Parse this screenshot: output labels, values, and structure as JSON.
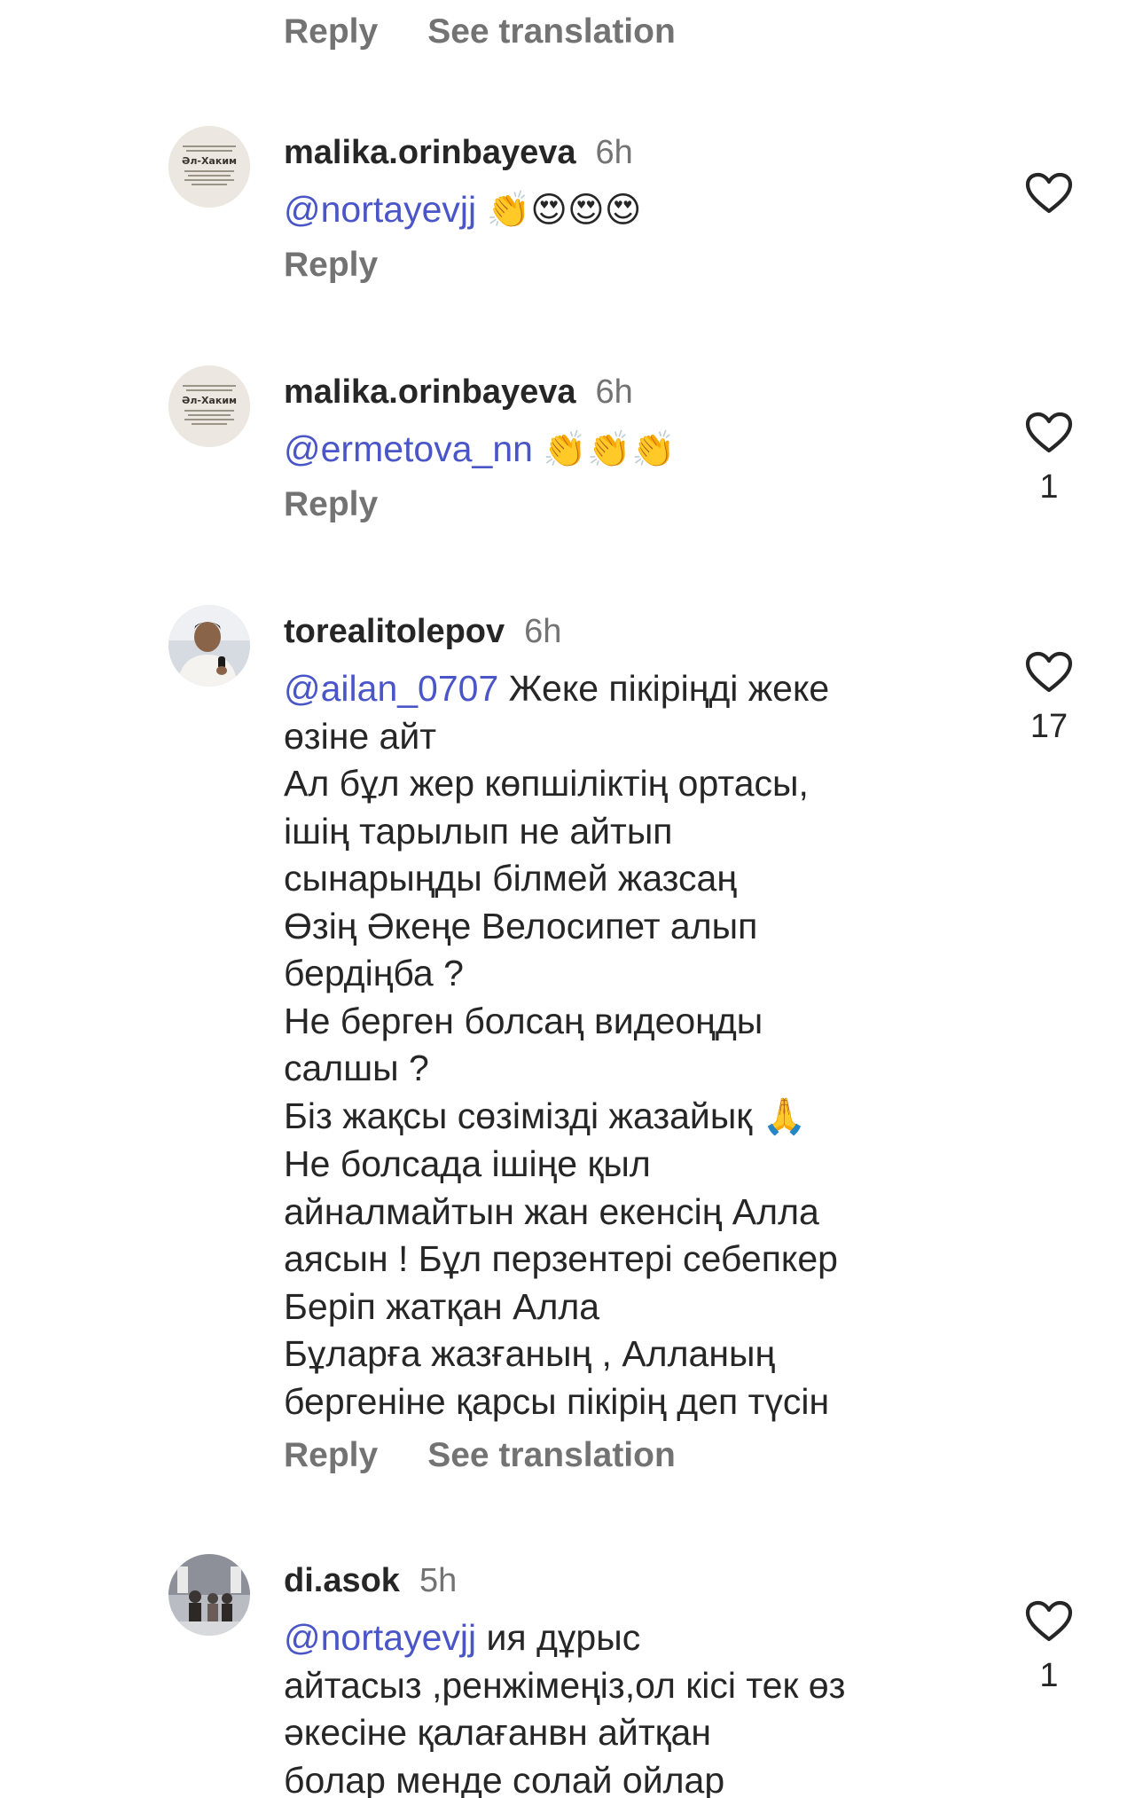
{
  "top_actions": {
    "reply": "Reply",
    "see_translation": "See translation"
  },
  "comments": [
    {
      "username": "malika.orinbayeva",
      "time": "6h",
      "avatar": {
        "title": "Әл-Хаким"
      },
      "mention": "@nortayevjj",
      "emoji": "👏😍😍😍",
      "lines": [],
      "reply": "Reply",
      "likes": ""
    },
    {
      "username": "malika.orinbayeva",
      "time": "6h",
      "avatar": {
        "title": "Әл-Хаким"
      },
      "mention": "@ermetova_nn",
      "emoji": "👏👏👏",
      "lines": [],
      "reply": "Reply",
      "likes": "1"
    },
    {
      "username": "torealitolepov",
      "time": "6h",
      "mention": "@ailan_0707",
      "first_line_rest": "Жеке пікіріңді жеке",
      "lines": [
        "өзіне айт",
        "Ал бұл жер көпшіліктің ортасы,",
        "ішің тарылып не айтып",
        "сынарыңды білмей жазсаң",
        "Өзің Әкеңе Велосипет алып",
        "бердіңба ?",
        "Не берген болсаң видеоңды",
        "салшы ?",
        "Біз жақсы сөзімізді жазайық",
        "Не болсада ішіңе қыл",
        "айналмайтын жан екенсің Алла",
        "аясын ! Бұл перзентері себепкер",
        "Беріп жатқан Алла",
        "Бұларға жазғаның , Алланың",
        "бергеніне қарсы пікірің деп түсін"
      ],
      "pray_emoji": "🙏",
      "reply": "Reply",
      "see_translation": "See translation",
      "likes": "17"
    },
    {
      "username": "di.asok",
      "time": "5h",
      "mention": "@nortayevjj",
      "first_line_rest": "ия дұрыс",
      "lines": [
        "айтасыз ,ренжімеңіз,ол кісі тек өз",
        "әкесіне қалағанвн айтқан",
        "болар менде солай ойлар"
      ],
      "likes": "1"
    }
  ],
  "icons": {
    "like": "heart-outline-icon"
  },
  "colors": {
    "mention": "#4a56c8",
    "secondary_text": "#737373",
    "primary_text": "#262626"
  }
}
